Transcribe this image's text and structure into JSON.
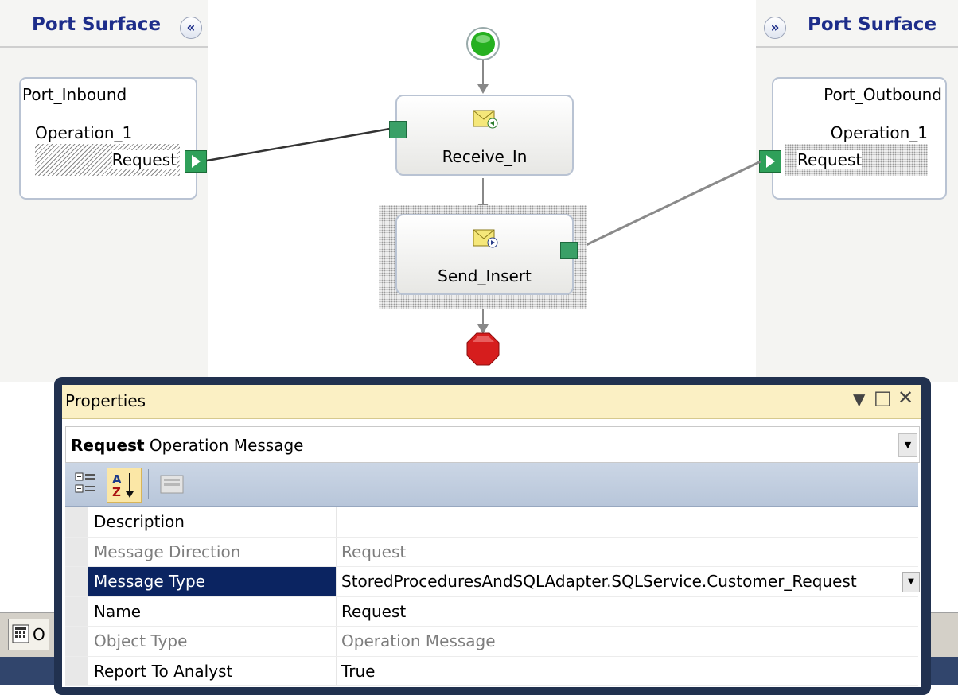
{
  "left_surface": {
    "title": "Port Surface",
    "collapse_label": "«"
  },
  "right_surface": {
    "title": "Port Surface",
    "expand_label": "»"
  },
  "port_inbound": {
    "name": "Port_Inbound",
    "operation": "Operation_1",
    "message": "Request"
  },
  "port_outbound": {
    "name": "Port_Outbound",
    "operation": "Operation_1",
    "message": "Request"
  },
  "shapes": [
    {
      "label": "Receive_In",
      "icon": "receive-envelope-icon"
    },
    {
      "label": "Send_Insert",
      "icon": "send-envelope-icon"
    }
  ],
  "colors": {
    "start": "#26b020",
    "stop": "#d61d1d",
    "selection": "#0b2461",
    "title_bar": "#fbf0c4"
  },
  "properties": {
    "title": "Properties",
    "object_name": "Request",
    "object_type": "Operation Message",
    "rows": [
      {
        "name": "Description",
        "value": ""
      },
      {
        "name": "Message Direction",
        "value": "Request"
      },
      {
        "name": "Message Type",
        "value": "StoredProceduresAndSQLAdapter.SQLService.Customer_Request"
      },
      {
        "name": "Name",
        "value": "Request"
      },
      {
        "name": "Object Type",
        "value": "Operation Message"
      },
      {
        "name": "Report To Analyst",
        "value": "True"
      }
    ]
  },
  "output_tab": {
    "label": "O"
  }
}
